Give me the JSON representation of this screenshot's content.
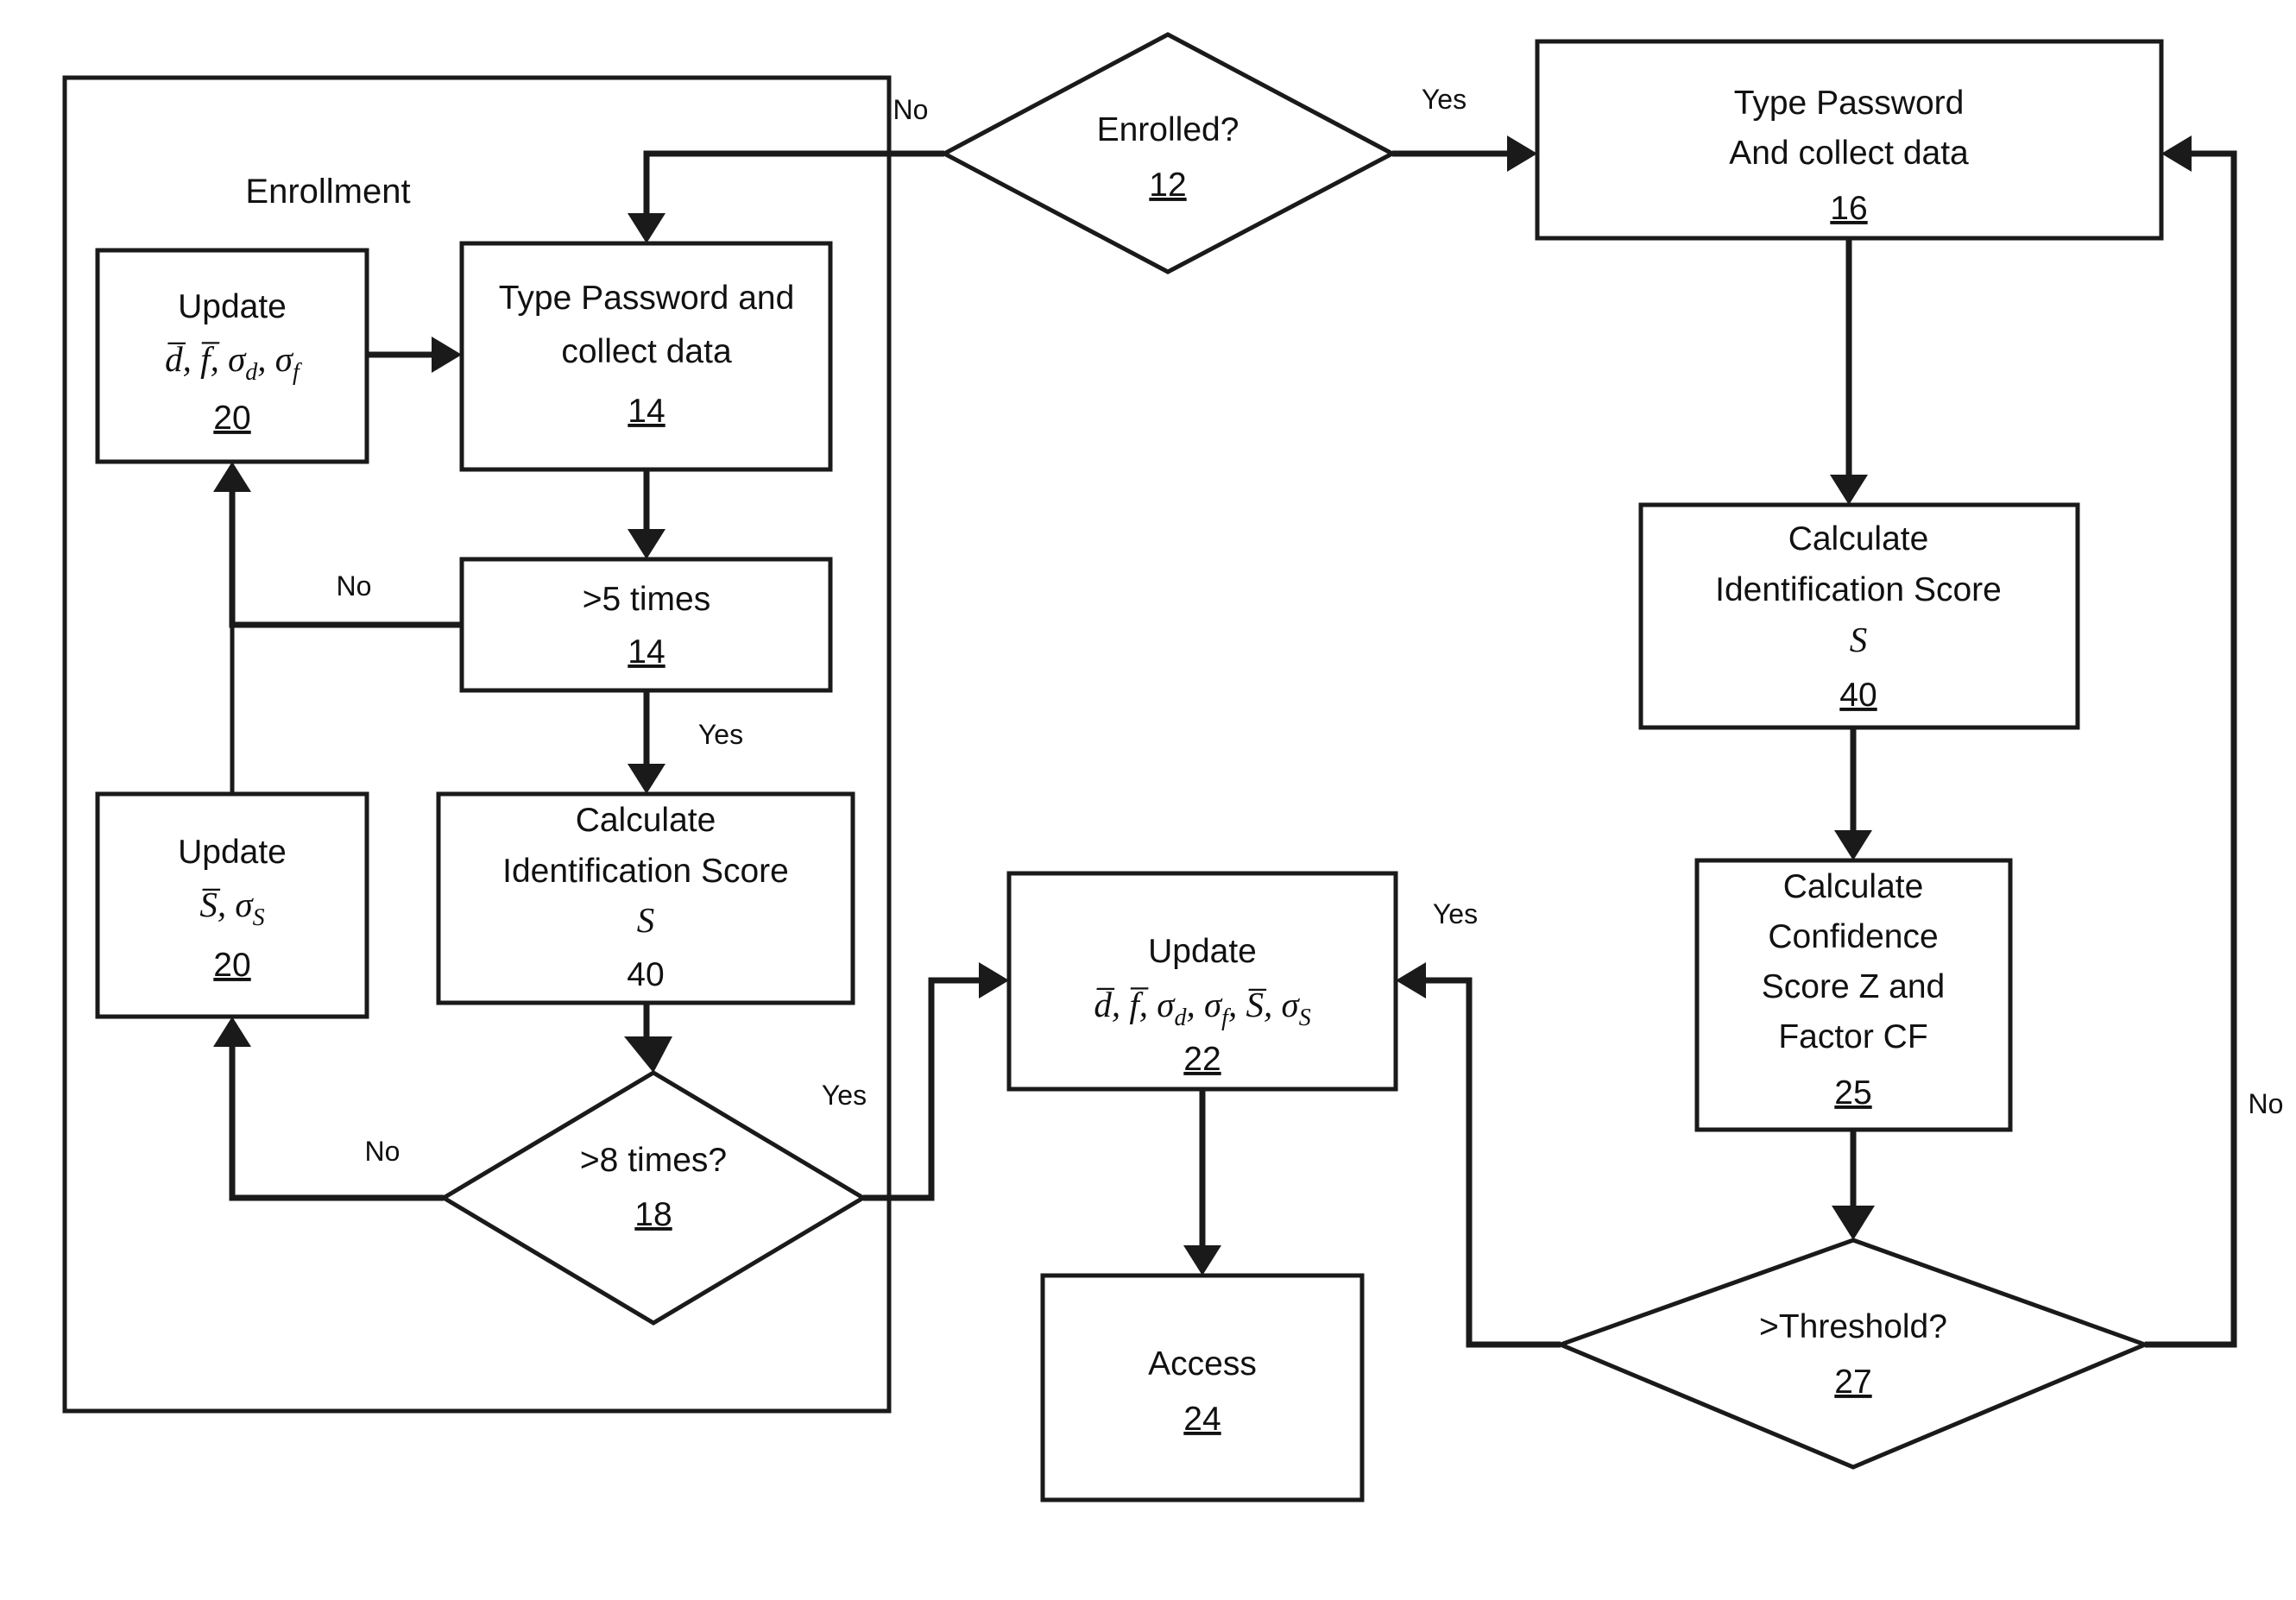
{
  "diagram": {
    "title": "Password typing biometric enrollment and authentication flowchart",
    "groups": [
      {
        "id": "enrollment",
        "label": "Enrollment"
      }
    ],
    "nodes": [
      {
        "id": "update20a",
        "shape": "process",
        "lines": [
          "Update"
        ],
        "math": "d̅, f̅, σd, σf",
        "ref": "20",
        "ref_underlined": true
      },
      {
        "id": "type14",
        "shape": "process",
        "lines": [
          "Type Password and",
          "collect data"
        ],
        "ref": "14",
        "ref_underlined": true
      },
      {
        "id": "gt5",
        "shape": "process",
        "lines": [
          ">5 times"
        ],
        "ref": "14",
        "ref_underlined": true
      },
      {
        "id": "update20b",
        "shape": "process",
        "lines": [
          "Update"
        ],
        "math": "S̅, σS",
        "ref": "20",
        "ref_underlined": true
      },
      {
        "id": "calc40a",
        "shape": "process",
        "lines": [
          "Calculate",
          "Identification Score"
        ],
        "math": "S",
        "ref": "40",
        "ref_underlined": false
      },
      {
        "id": "gt8",
        "shape": "decision",
        "lines": [
          ">8 times?"
        ],
        "ref": "18",
        "ref_underlined": true
      },
      {
        "id": "enrolled12",
        "shape": "decision",
        "lines": [
          "Enrolled?"
        ],
        "ref": "12",
        "ref_underlined": true
      },
      {
        "id": "type16",
        "shape": "process",
        "lines": [
          "Type Password",
          "And collect data"
        ],
        "ref": "16",
        "ref_underlined": true
      },
      {
        "id": "calc40b",
        "shape": "process",
        "lines": [
          "Calculate",
          "Identification Score"
        ],
        "math": "S",
        "ref": "40",
        "ref_underlined": true
      },
      {
        "id": "calc25",
        "shape": "process",
        "lines": [
          "Calculate",
          "Confidence",
          "Score Z and",
          "Factor CF"
        ],
        "ref": "25",
        "ref_underlined": true
      },
      {
        "id": "threshold27",
        "shape": "decision",
        "lines": [
          ">Threshold?"
        ],
        "ref": "27",
        "ref_underlined": true
      },
      {
        "id": "update22",
        "shape": "process",
        "lines": [
          "Update"
        ],
        "math": "d̅, f̅, σd, σf, S̅, σS",
        "ref": "22",
        "ref_underlined": true
      },
      {
        "id": "access24",
        "shape": "process",
        "lines": [
          "Access"
        ],
        "ref": "24",
        "ref_underlined": true
      }
    ],
    "edge_labels": {
      "enrolled_no": "No",
      "enrolled_yes": "Yes",
      "gt5_no": "No",
      "gt5_yes": "Yes",
      "gt8_no": "No",
      "gt8_yes": "Yes",
      "threshold_yes": "Yes",
      "threshold_no": "No"
    },
    "colors": {
      "ink": "#1a1a1a",
      "paper": "#ffffff"
    }
  }
}
